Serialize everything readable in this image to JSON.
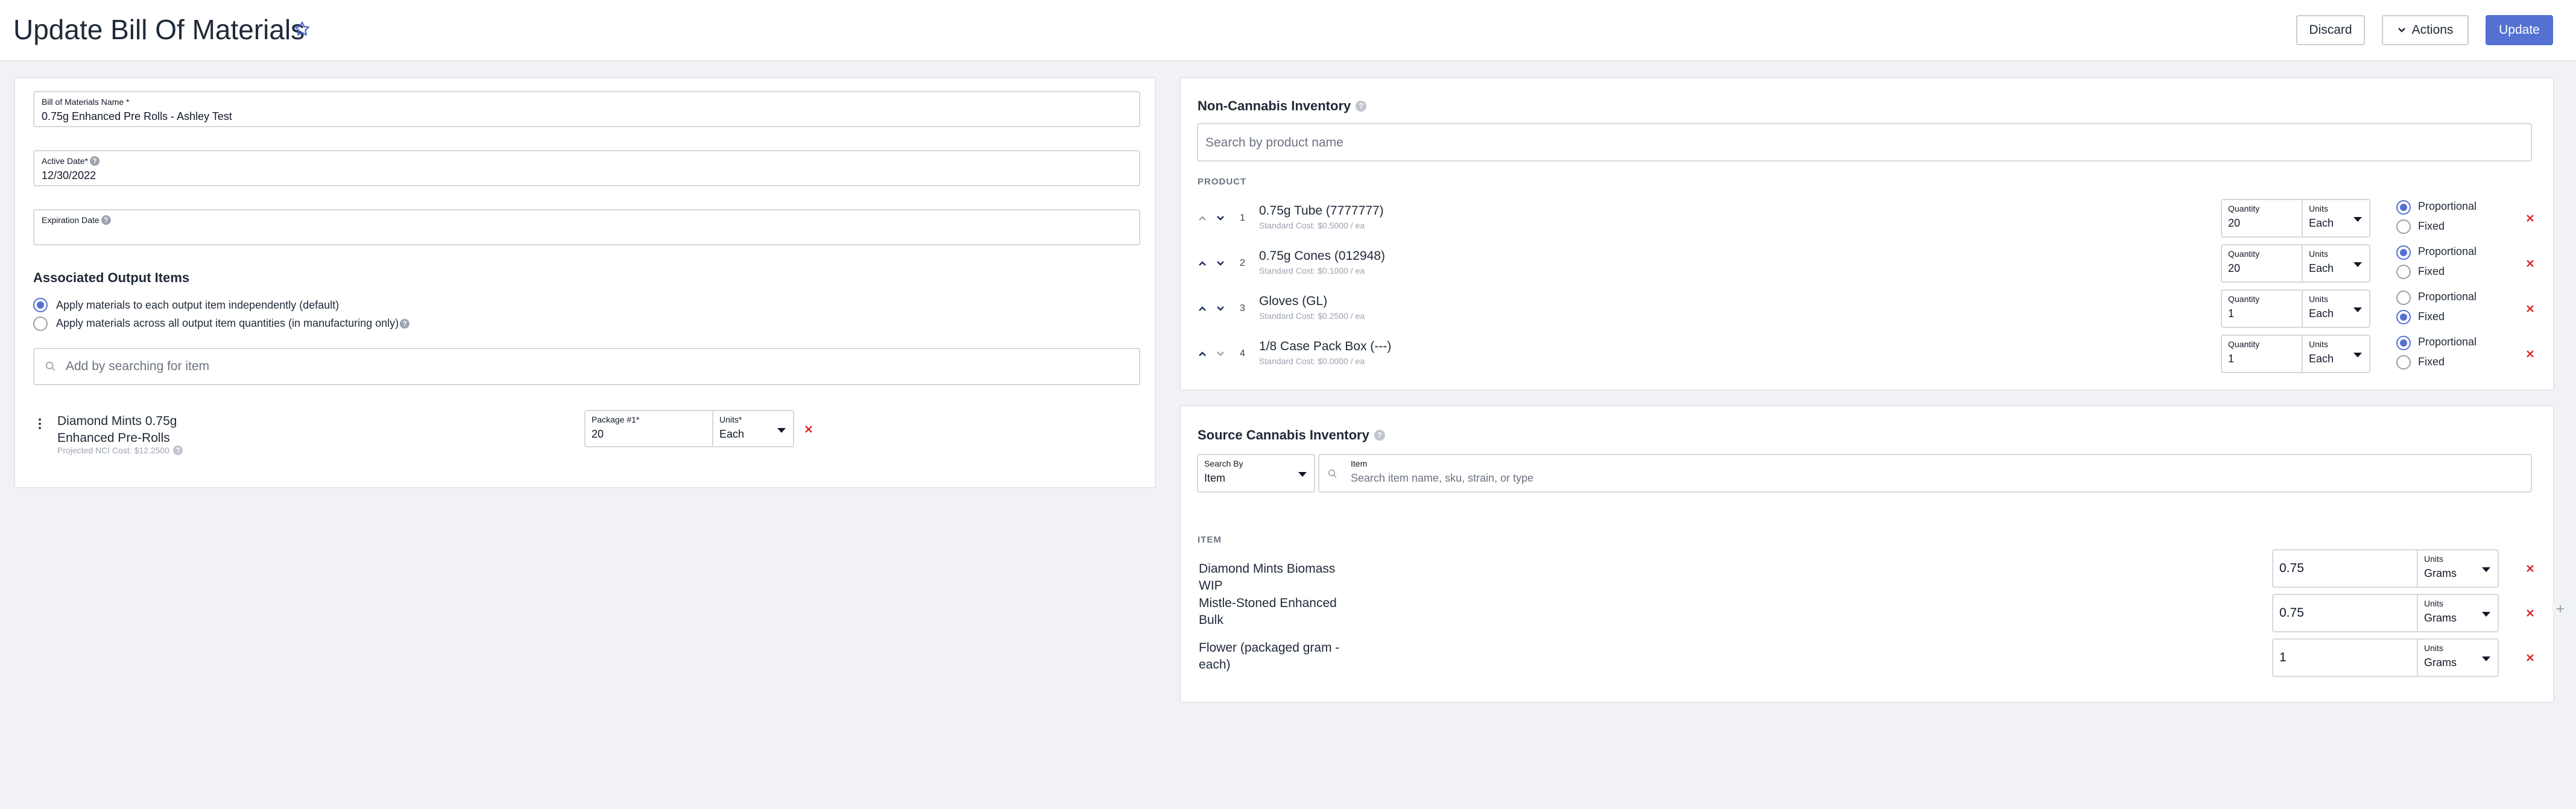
{
  "header": {
    "title": "Update Bill Of Materials",
    "discard_label": "Discard",
    "actions_label": "Actions",
    "update_label": "Update"
  },
  "form": {
    "bom_name_label": "Bill of Materials Name *",
    "bom_name_value": "0.75g Enhanced Pre Rolls - Ashley Test",
    "active_date_label": "Active Date*",
    "active_date_value": "12/30/2022",
    "expiration_date_label": "Expiration Date",
    "expiration_date_value": ""
  },
  "output": {
    "title": "Associated Output Items",
    "option_independent": "Apply materials to each output item independently (default)",
    "option_across": "Apply materials across all output item quantities (in manufacturing only)",
    "selected_option": "independent",
    "search_placeholder": "Add by searching for item",
    "item": {
      "name": "Diamond Mints 0.75g Enhanced Pre-Rolls",
      "projected_cost": "Projected NCI Cost: $12.2500",
      "package_label": "Package #1*",
      "package_value": "20",
      "units_label": "Units*",
      "units_value": "Each"
    }
  },
  "nci": {
    "title": "Non-Cannabis Inventory",
    "search_placeholder": "Search by product name",
    "column_header": "PRODUCT",
    "quantity_label": "Quantity",
    "units_label": "Units",
    "proportional_label": "Proportional",
    "fixed_label": "Fixed",
    "rows": [
      {
        "num": "1",
        "name": "0.75g Tube (7777777)",
        "cost": "Standard Cost: $0.5000 / ea",
        "quantity": "20",
        "units": "Each",
        "mode": "proportional"
      },
      {
        "num": "2",
        "name": "0.75g Cones (012948)",
        "cost": "Standard Cost: $0.1000 / ea",
        "quantity": "20",
        "units": "Each",
        "mode": "proportional"
      },
      {
        "num": "3",
        "name": "Gloves (GL)",
        "cost": "Standard Cost: $0.2500 / ea",
        "quantity": "1",
        "units": "Each",
        "mode": "fixed"
      },
      {
        "num": "4",
        "name": "1/8 Case Pack Box (---)",
        "cost": "Standard Cost: $0.0000 / ea",
        "quantity": "1",
        "units": "Each",
        "mode": "proportional"
      }
    ]
  },
  "ci": {
    "title": "Source Cannabis Inventory",
    "search_by_label": "Search By",
    "search_by_value": "Item",
    "item_label": "Item",
    "item_placeholder": "Search item name, sku, strain, or type",
    "column_header": "ITEM",
    "units_label": "Units",
    "rows": [
      {
        "name": "Diamond Mints Biomass WIP",
        "quantity": "0.75",
        "units": "Grams"
      },
      {
        "name": "Mistle-Stoned Enhanced Bulk",
        "quantity": "0.75",
        "units": "Grams"
      },
      {
        "name": "Flower (packaged gram - each)",
        "quantity": "1",
        "units": "Grams"
      }
    ]
  },
  "colors": {
    "accent": "#5470d1",
    "remove": "#dc2626",
    "background": "#f1f2f6"
  }
}
